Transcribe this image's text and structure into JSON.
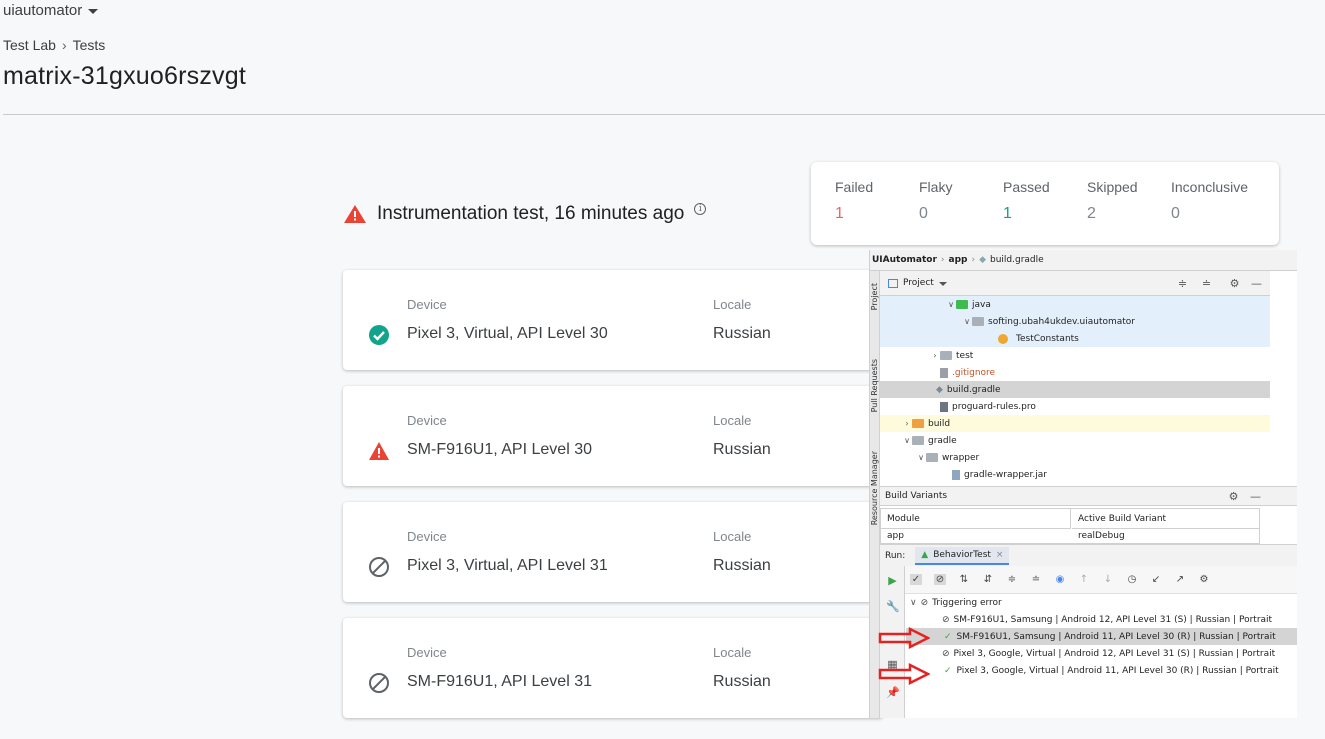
{
  "header": {
    "project": "uiautomator",
    "breadcrumb": [
      "Test Lab",
      "Tests"
    ],
    "title": "matrix-31gxuo6rszvgt"
  },
  "summary": [
    {
      "label": "Failed",
      "value": "1",
      "color": "#e8675f"
    },
    {
      "label": "Flaky",
      "value": "0",
      "color": "#80868b"
    },
    {
      "label": "Passed",
      "value": "1",
      "color": "#12a38a"
    },
    {
      "label": "Skipped",
      "value": "2",
      "color": "#80868b"
    },
    {
      "label": "Inconclusive",
      "value": "0",
      "color": "#80868b"
    }
  ],
  "run_title": "Instrumentation test, 16 minutes ago",
  "device_label": "Device",
  "locale_label": "Locale",
  "devices": [
    {
      "status": "passed",
      "device": "Pixel 3, Virtual, API Level 30",
      "locale": "Russian"
    },
    {
      "status": "failed",
      "device": "SM-F916U1, API Level 30",
      "locale": "Russian"
    },
    {
      "status": "skipped",
      "device": "Pixel 3, Virtual, API Level 31",
      "locale": "Russian"
    },
    {
      "status": "skipped",
      "device": "SM-F916U1, API Level 31",
      "locale": "Russian"
    }
  ],
  "colors": {
    "passed": "#12a38a",
    "failed": "#ea4335",
    "skipped": "#5f6368"
  },
  "ide": {
    "breadcrumb": [
      "UIAutomator",
      "app",
      "build.gradle"
    ],
    "side_tabs": [
      "Project",
      "Pull Requests",
      "Resource Manager"
    ],
    "project_label": "Project",
    "tree": [
      {
        "indent": 4,
        "arrow": "v",
        "icon": "folder-green",
        "text": "java",
        "hl": true
      },
      {
        "indent": 5,
        "arrow": "v",
        "icon": "folder-grey",
        "text": "softing.ubah4ukdev.uiautomator",
        "hl": true
      },
      {
        "indent": 7,
        "arrow": "",
        "icon": "class",
        "text": "TestConstants",
        "hl": true
      },
      {
        "indent": 3,
        "arrow": ">",
        "icon": "folder-grey",
        "text": "test",
        "hl": false
      },
      {
        "indent": 3,
        "arrow": "",
        "icon": "file",
        "text": ".gitignore",
        "hl": false,
        "color": "#c0562a"
      },
      {
        "indent": 3,
        "arrow": "",
        "icon": "gradle",
        "text": "build.gradle",
        "hl": false,
        "selected": true
      },
      {
        "indent": 3,
        "arrow": "",
        "icon": "file",
        "text": "proguard-rules.pro",
        "hl": false
      },
      {
        "indent": 1,
        "arrow": ">",
        "icon": "folder-orange",
        "text": "build",
        "hl": false,
        "yellow": true
      },
      {
        "indent": 1,
        "arrow": "v",
        "icon": "folder-grey",
        "text": "gradle",
        "hl": false
      },
      {
        "indent": 2,
        "arrow": "v",
        "icon": "folder-grey",
        "text": "wrapper",
        "hl": false
      },
      {
        "indent": 4,
        "arrow": "",
        "icon": "file",
        "text": "gradle-wrapper.jar",
        "hl": false
      }
    ],
    "build_variants": "Build Variants",
    "bv_cols": [
      "Module",
      "Active Build Variant"
    ],
    "bv_row": [
      "app",
      "realDebug"
    ],
    "run_label": "Run:",
    "run_tab": "BehaviorTest",
    "results": [
      {
        "type": "skip",
        "text": "Triggering error",
        "indent": 0
      },
      {
        "type": "skip",
        "text": "SM-F916U1, Samsung | Android 12, API Level 31 (S) | Russian | Portrait",
        "indent": 2
      },
      {
        "type": "ok",
        "text": "SM-F916U1, Samsung | Android 11, API Level 30 (R) | Russian | Portrait",
        "indent": 2,
        "selected": true
      },
      {
        "type": "skip",
        "text": "Pixel 3, Google, Virtual | Android 12, API Level 31 (S) | Russian | Portrait",
        "indent": 2
      },
      {
        "type": "ok",
        "text": "Pixel 3, Google, Virtual | Android 11, API Level 30 (R) | Russian | Portrait",
        "indent": 2
      }
    ]
  }
}
